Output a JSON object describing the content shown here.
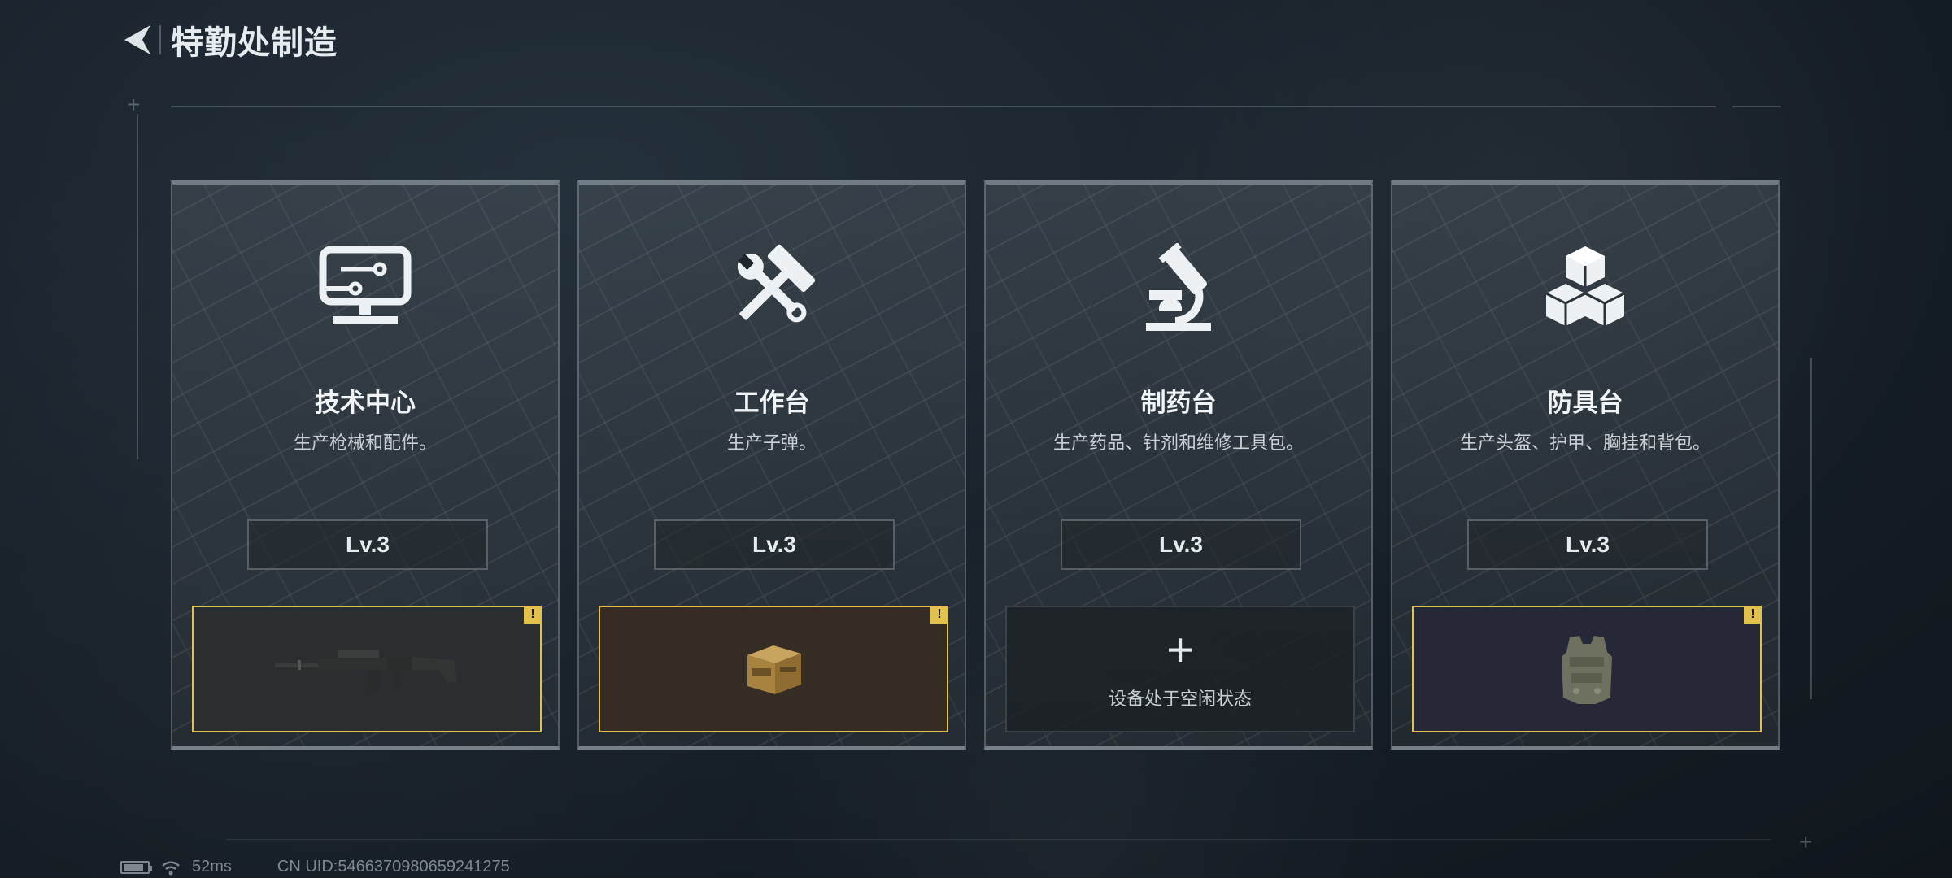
{
  "header": {
    "title": "特勤处制造"
  },
  "cards": [
    {
      "name": "技术中心",
      "desc": "生产枪械和配件。",
      "level": "Lv.3",
      "icon": "monitor-icon",
      "slot": {
        "state": "producing",
        "item": "assault-rifle",
        "bg": "#2a2e30",
        "badge": "!"
      }
    },
    {
      "name": "工作台",
      "desc": "生产子弹。",
      "level": "Lv.3",
      "icon": "hammer-wrench-icon",
      "slot": {
        "state": "producing",
        "item": "ammo-crate",
        "bg": "#352c24",
        "badge": "!"
      }
    },
    {
      "name": "制药台",
      "desc": "生产药品、针剂和维修工具包。",
      "level": "Lv.3",
      "icon": "microscope-icon",
      "slot": {
        "state": "idle",
        "plus": "+",
        "idle_text": "设备处于空闲状态"
      }
    },
    {
      "name": "防具台",
      "desc": "生产头盔、护甲、胸挂和背包。",
      "level": "Lv.3",
      "icon": "cubes-icon",
      "slot": {
        "state": "producing",
        "item": "body-armor",
        "bg": "#262838",
        "badge": "!"
      }
    }
  ],
  "status": {
    "ping": "52ms",
    "uid": "CN UID:5466370980659241275",
    "battery_level": 0.85
  },
  "colors": {
    "accent": "#e3c14d",
    "background": "#18212a"
  }
}
